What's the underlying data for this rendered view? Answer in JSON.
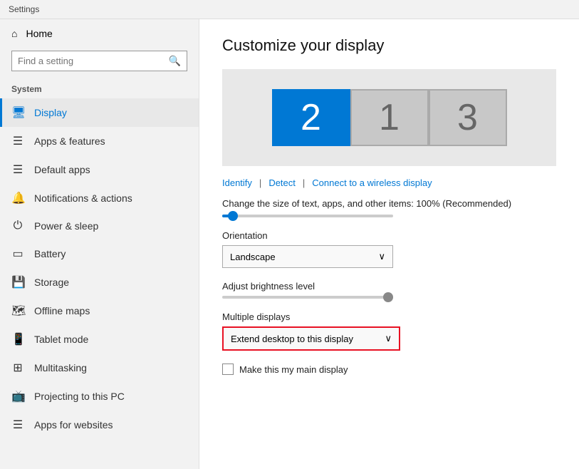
{
  "titleBar": {
    "label": "Settings"
  },
  "sidebar": {
    "searchPlaceholder": "Find a setting",
    "sectionLabel": "System",
    "homeLabel": "Home",
    "items": [
      {
        "id": "display",
        "label": "Display",
        "icon": "⬜",
        "active": true
      },
      {
        "id": "apps-features",
        "label": "Apps & features",
        "icon": "≡",
        "active": false
      },
      {
        "id": "default-apps",
        "label": "Default apps",
        "icon": "≡",
        "active": false
      },
      {
        "id": "notifications",
        "label": "Notifications & actions",
        "icon": "💬",
        "active": false
      },
      {
        "id": "power-sleep",
        "label": "Power & sleep",
        "icon": "⏻",
        "active": false
      },
      {
        "id": "battery",
        "label": "Battery",
        "icon": "🔋",
        "active": false
      },
      {
        "id": "storage",
        "label": "Storage",
        "icon": "💾",
        "active": false
      },
      {
        "id": "offline-maps",
        "label": "Offline maps",
        "icon": "🗺",
        "active": false
      },
      {
        "id": "tablet-mode",
        "label": "Tablet mode",
        "icon": "📱",
        "active": false
      },
      {
        "id": "multitasking",
        "label": "Multitasking",
        "icon": "⊞",
        "active": false
      },
      {
        "id": "projecting",
        "label": "Projecting to this PC",
        "icon": "📺",
        "active": false
      },
      {
        "id": "apps-websites",
        "label": "Apps for websites",
        "icon": "≡",
        "active": false
      }
    ]
  },
  "content": {
    "title": "Customize your display",
    "displays": [
      {
        "id": 2,
        "active": true
      },
      {
        "id": 1,
        "active": false
      },
      {
        "id": 3,
        "active": false
      }
    ],
    "actions": {
      "identify": "Identify",
      "detect": "Detect",
      "connect": "Connect to a wireless display"
    },
    "scaleText": "Change the size of text, apps, and other items: 100% (Recommended)",
    "orientationLabel": "Orientation",
    "orientationValue": "Landscape",
    "brightnessLabel": "Adjust brightness level",
    "multipleDisplaysLabel": "Multiple displays",
    "multipleDisplaysValue": "Extend desktop to this display",
    "mainDisplayLabel": "Make this my main display",
    "chevron": "∨"
  }
}
